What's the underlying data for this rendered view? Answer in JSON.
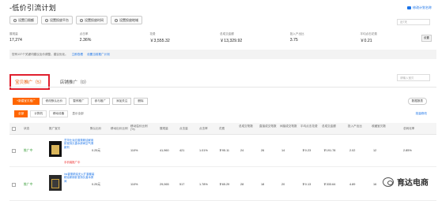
{
  "page": {
    "title": "-低价引流计划",
    "top_link": "修改计划名称"
  },
  "actions": [
    "设置日限额",
    "设置投放平台",
    "设置投放时间",
    "设置投放地域"
  ],
  "date_range": "近7天",
  "stats": [
    {
      "label": "展现量",
      "value": "17,274"
    },
    {
      "label": "点击率",
      "value": "2.36%"
    },
    {
      "label": "花费",
      "value": "￥3,555.32"
    },
    {
      "label": "总成交金额",
      "value": "￥13,329.92"
    },
    {
      "label": "投入产出比",
      "value": "3.75"
    },
    {
      "label": "平均点击花费",
      "value": "￥0.21"
    }
  ],
  "stats_button": "设置",
  "info_bar": {
    "text": "您有137个关键词建议出价调整，建议优化。",
    "link1": "立即查看",
    "link2": "设置当前推广计划"
  },
  "tabs": [
    {
      "label": "宝贝推广（5）",
      "active": true
    },
    {
      "label": "店铺推广（0）",
      "active": false
    }
  ],
  "tab_search": "请输入宝贝",
  "toolbar": [
    "+新建宝贝推广",
    "修改默认出价",
    "暂停推广",
    "参与推广",
    "添加关注",
    "删除"
  ],
  "toolbar_right": "数据报表",
  "filters": {
    "buttons": [
      "全部",
      "计算机",
      "移动设备"
    ],
    "select_label": "显示全部",
    "right_link": "批量修改"
  },
  "table": {
    "headers": [
      "状态",
      "推广宝贝",
      "默认出价",
      "移动出价比例",
      "移动溢价比例(%)",
      "展现量",
      "点击量",
      "点击率",
      "花费",
      "总成交笔数",
      "直接成交笔数",
      "间接成交笔数",
      "平均点击花费",
      "总成交金额",
      "投入产出比",
      "收藏宝贝数",
      "总转化率"
    ],
    "rows": [
      {
        "status": "推广中",
        "product": "芝华仕对应香薰精油家用卧室持久香水房间空气清新剂",
        "tag": "手机端推广中",
        "default_bid": "0.25元",
        "mobile_ratio": "110%",
        "values": [
          "41,960",
          "421",
          "1.01%",
          "￥95.11",
          "24",
          "26",
          "14",
          "￥0.23",
          "￥191.78",
          "2.02",
          "12",
          "2.85%"
        ]
      },
      {
        "status": "推广中",
        "product": "ins香薰精油无火扩香套装精油家用卧室持久香水房间",
        "tag": "",
        "default_bid": "0.25元",
        "mobile_ratio": "110%",
        "values": [
          "29,065",
          "517",
          "1.78%",
          "￥65.29",
          "28",
          "18",
          "20",
          "￥0.13",
          "￥333.64",
          "4.89",
          "16",
          "3.27%"
        ]
      }
    ]
  },
  "watermark": "育达电商"
}
